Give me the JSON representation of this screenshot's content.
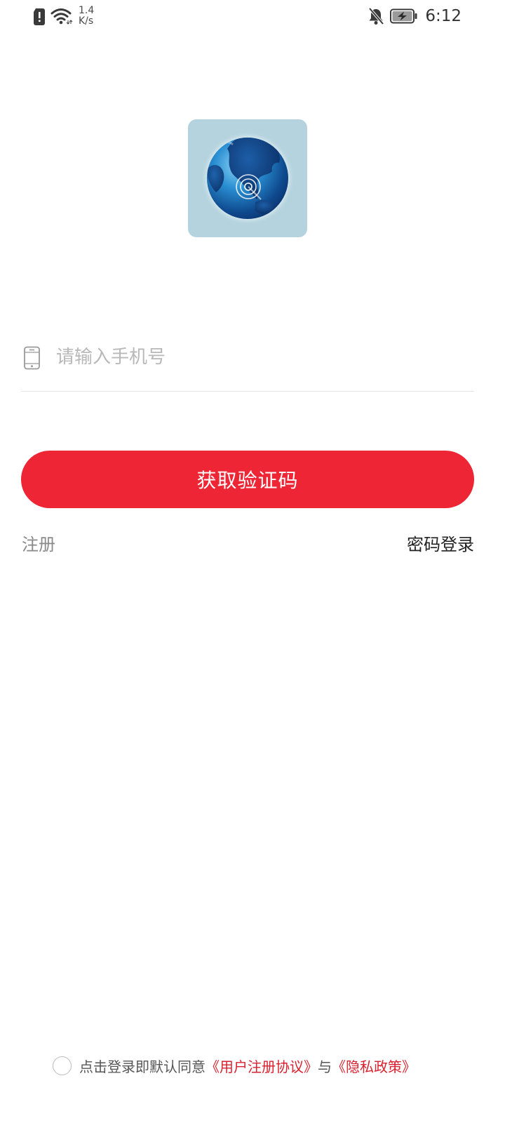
{
  "status_bar": {
    "net_speed_value": "1.4",
    "net_speed_unit": "K/s",
    "time": "6:12"
  },
  "login": {
    "phone_placeholder": "请输入手机号",
    "phone_value": "",
    "get_code_label": "获取验证码",
    "register_label": "注册",
    "password_login_label": "密码登录"
  },
  "agreement": {
    "prefix": "点击登录即默认同意",
    "user_agreement": "《用户注册协议》",
    "connector": "与",
    "privacy_policy": "《隐私政策》",
    "checked": false
  },
  "colors": {
    "accent": "#ee2535",
    "link_red": "#d8222f",
    "logo_bg": "#b4d3de"
  },
  "icons": {
    "status": [
      "sim-alert-icon",
      "wifi-icon",
      "bell-off-icon",
      "battery-charging-icon"
    ],
    "input": "phone-icon",
    "logo": "globe-logo-icon"
  }
}
